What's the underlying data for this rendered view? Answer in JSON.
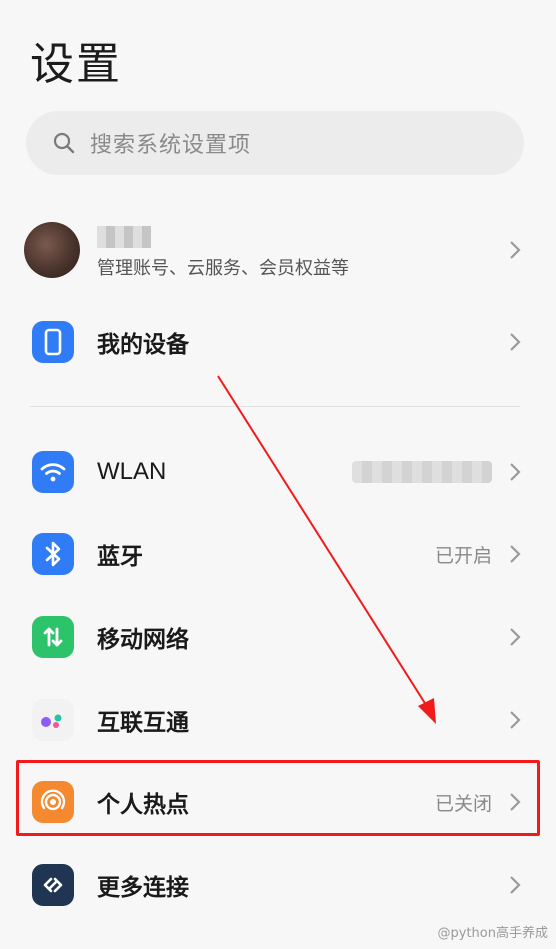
{
  "header": {
    "title": "设置"
  },
  "search": {
    "placeholder": "搜索系统设置项"
  },
  "account": {
    "subtitle": "管理账号、云服务、会员权益等"
  },
  "items": {
    "my_device": {
      "label": "我的设备",
      "icon": "phone-icon",
      "color": "#2f7cf6"
    },
    "wlan": {
      "label": "WLAN",
      "icon": "wifi-icon",
      "color": "#2f7cf6"
    },
    "bluetooth": {
      "label": "蓝牙",
      "value": "已开启",
      "icon": "bluetooth-icon",
      "color": "#2f7cf6"
    },
    "mobile_network": {
      "label": "移动网络",
      "icon": "mobile-data-icon",
      "color": "#2dc36a"
    },
    "interconnect": {
      "label": "互联互通",
      "icon": "interconnect-icon",
      "color": "#f2f2f2"
    },
    "hotspot": {
      "label": "个人热点",
      "value": "已关闭",
      "icon": "hotspot-icon",
      "color": "#f5892f"
    },
    "more_connections": {
      "label": "更多连接",
      "icon": "link-icon",
      "color": "#1f3552"
    }
  },
  "annotation": {
    "highlight_color": "#f21b1b"
  },
  "watermark": "@python高手养成"
}
